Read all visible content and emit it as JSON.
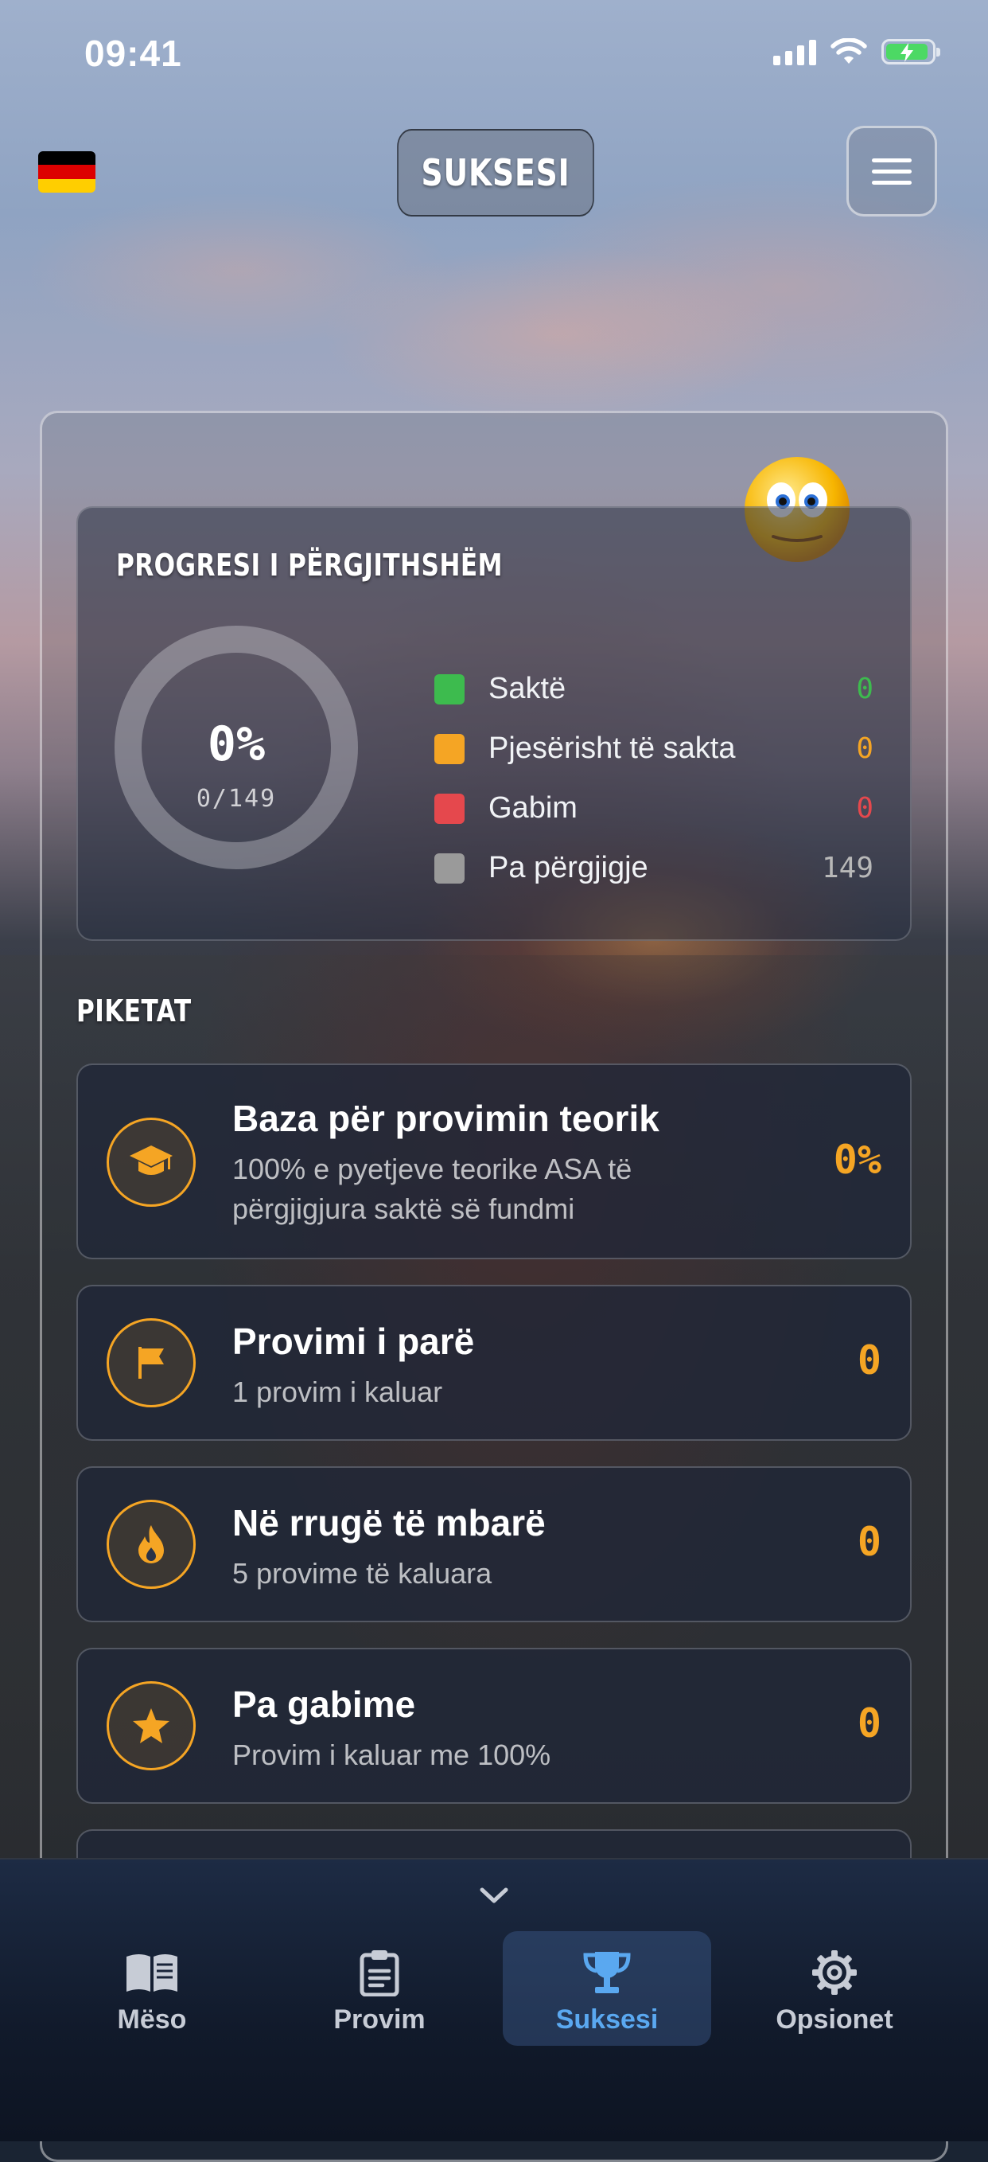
{
  "status_bar": {
    "time": "09:41"
  },
  "header": {
    "title": "SUKSESI",
    "language": "de"
  },
  "colors": {
    "correct": "#3dbb4e",
    "partial": "#f5a524",
    "wrong": "#e5484d",
    "unanswered": "#9a9a9a",
    "accent_active": "#5aa8f0"
  },
  "progress": {
    "title": "PROGRESI I PËRGJITHSHËM",
    "percent_text": "0%",
    "count_text": "0/149",
    "progress_fraction": 0,
    "legend": [
      {
        "label": "Saktë",
        "value": "0",
        "color": "#3dbb4e"
      },
      {
        "label": "Pjesërisht të sakta",
        "value": "0",
        "color": "#f5a524"
      },
      {
        "label": "Gabim",
        "value": "0",
        "color": "#e5484d"
      },
      {
        "label": "Pa përgjigje",
        "value": "149",
        "color": "#9a9a9a"
      }
    ]
  },
  "badges": {
    "title": "PIKETAT",
    "items": [
      {
        "icon": "graduation-cap-icon",
        "title": "Baza për provimin teorik",
        "subtitle": "100% e pyetjeve teorike ASA të përgjigjura saktë së fundmi",
        "value": "0%"
      },
      {
        "icon": "flag-icon",
        "title": "Provimi i parë",
        "subtitle": "1 provim i kaluar",
        "value": "0"
      },
      {
        "icon": "flame-icon",
        "title": "Në rrugë të mbarë",
        "subtitle": "5 provime të kaluara",
        "value": "0"
      },
      {
        "icon": "star-icon",
        "title": "Pa gabime",
        "subtitle": "Provim i kaluar me 100%",
        "value": "0"
      }
    ]
  },
  "nav": {
    "tabs": [
      {
        "label": "Mëso",
        "icon": "book-icon",
        "active": false
      },
      {
        "label": "Provim",
        "icon": "clipboard-icon",
        "active": false
      },
      {
        "label": "Suksesi",
        "icon": "trophy-icon",
        "active": true
      },
      {
        "label": "Opsionet",
        "icon": "gear-icon",
        "active": false
      }
    ]
  }
}
